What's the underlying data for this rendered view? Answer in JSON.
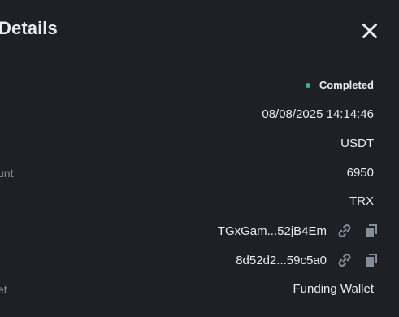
{
  "header": {
    "title": "Details",
    "close_icon": "close-icon"
  },
  "rows": {
    "status": {
      "label": "",
      "value": "Completed",
      "status_color": "#2ebd85"
    },
    "date": {
      "label": "",
      "value": "08/08/2025 14:14:46"
    },
    "coin": {
      "label": "",
      "value": "USDT"
    },
    "amount": {
      "label": "unt",
      "value": "6950"
    },
    "network": {
      "label": "",
      "value": "TRX"
    },
    "address": {
      "label": "",
      "value": "TGxGam...52jB4Em",
      "icons": [
        "link-icon",
        "copy-icon"
      ]
    },
    "txid": {
      "label": "",
      "value": "8d52d2...59c5a0",
      "icons": [
        "link-icon",
        "copy-icon"
      ]
    },
    "wallet": {
      "label": "et",
      "value": "Funding Wallet"
    }
  },
  "colors": {
    "background": "#1e2026",
    "text_primary": "#eaecef",
    "text_secondary": "#848e9c",
    "success": "#2ebd85"
  }
}
